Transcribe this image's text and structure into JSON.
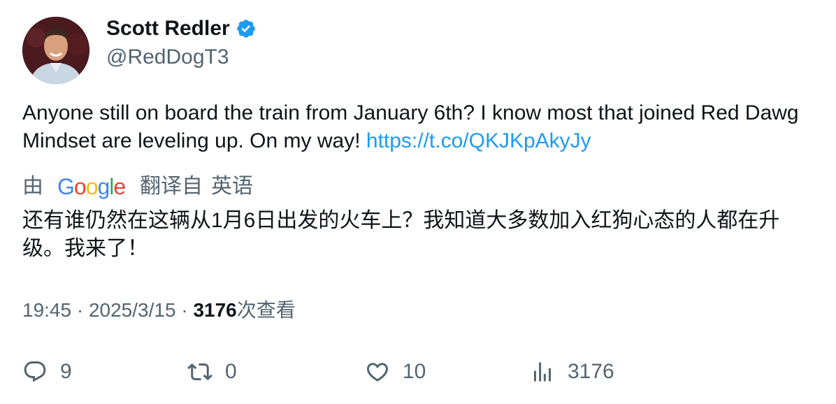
{
  "author": {
    "name": "Scott Redler",
    "handle": "@RedDogT3",
    "verified_color": "#1d9bf0"
  },
  "tweet": {
    "text": "Anyone still on board the train from January 6th?  I know most that joined Red Dawg Mindset are leveling up. On my way! ",
    "link": "https://t.co/QKJKpAkyJy"
  },
  "translation": {
    "by": "由",
    "provider": "Google",
    "translated_from": "翻译自",
    "language": "英语",
    "text": "还有谁仍然在这辆从1月6日出发的火车上？我知道大多数加入红狗心态的人都在升级。我来了！"
  },
  "meta": {
    "time": "19:45",
    "sep1": " · ",
    "date": "2025/3/15",
    "sep2": " · ",
    "views": "3176",
    "views_label": "次查看"
  },
  "actions": {
    "reply_count": "9",
    "retweet_count": "0",
    "like_count": "10",
    "views_count": "3176"
  },
  "colors": {
    "text": "#0f1419",
    "secondary": "#536471",
    "link": "#1d9bf0"
  }
}
